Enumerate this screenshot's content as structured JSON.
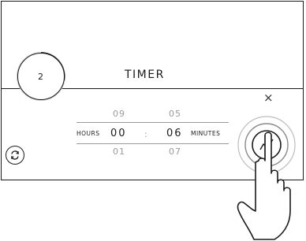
{
  "header": {
    "title": "TIMER",
    "step_number": "2"
  },
  "picker": {
    "hours": {
      "prev": "09",
      "current": "00",
      "next": "01",
      "label": "HOURS"
    },
    "separator": ":",
    "minutes": {
      "prev": "05",
      "current": "06",
      "next": "07",
      "label": "MINUTES"
    }
  },
  "icons": {
    "close": "close-icon",
    "reset": "reset-icon",
    "start": "start-button-icon",
    "hand": "pointing-hand-icon"
  },
  "close_glyph": "×"
}
